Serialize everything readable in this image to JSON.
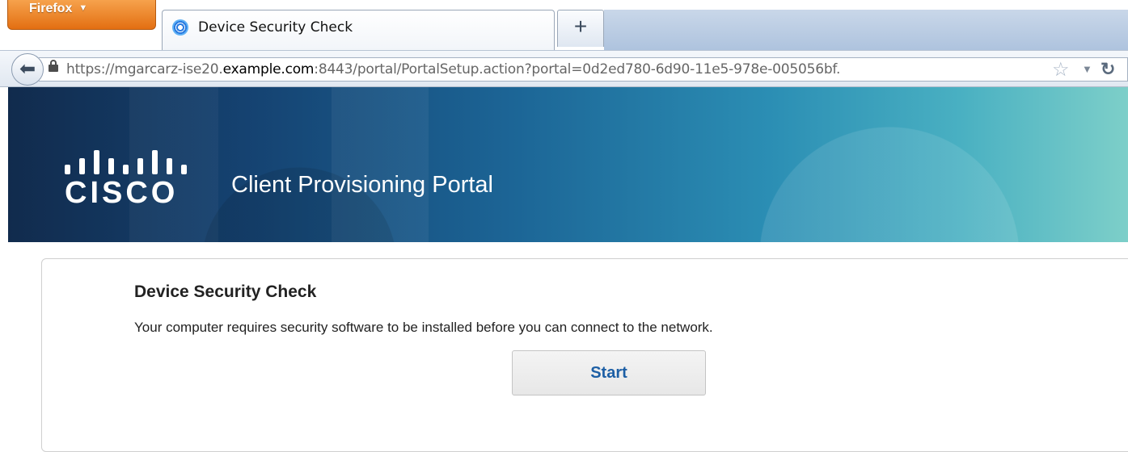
{
  "browser": {
    "menu_button": "Firefox",
    "tab": {
      "title": "Device Security Check"
    },
    "new_tab_label": "+",
    "url": {
      "prefix": "https://mgarcarz-ise20.",
      "domain": "example.com",
      "suffix": ":8443/portal/PortalSetup.action?portal=0d2ed780-6d90-11e5-978e-005056bf."
    }
  },
  "header": {
    "logo_text": "CISCO",
    "portal_title": "Client Provisioning Portal"
  },
  "main": {
    "title": "Device Security Check",
    "message": "Your computer requires security software to be installed before you can connect to the network.",
    "start_button": "Start"
  },
  "colors": {
    "accent": "#1d5fa5",
    "banner_dark": "#112b4d",
    "banner_light": "#7dcfc9",
    "firefox_orange": "#e36f12"
  },
  "icons": [
    "firefox-menu-icon",
    "browser-favicon",
    "back-arrow-icon",
    "lock-icon",
    "bookmark-star-icon",
    "dropdown-icon",
    "reload-icon"
  ]
}
